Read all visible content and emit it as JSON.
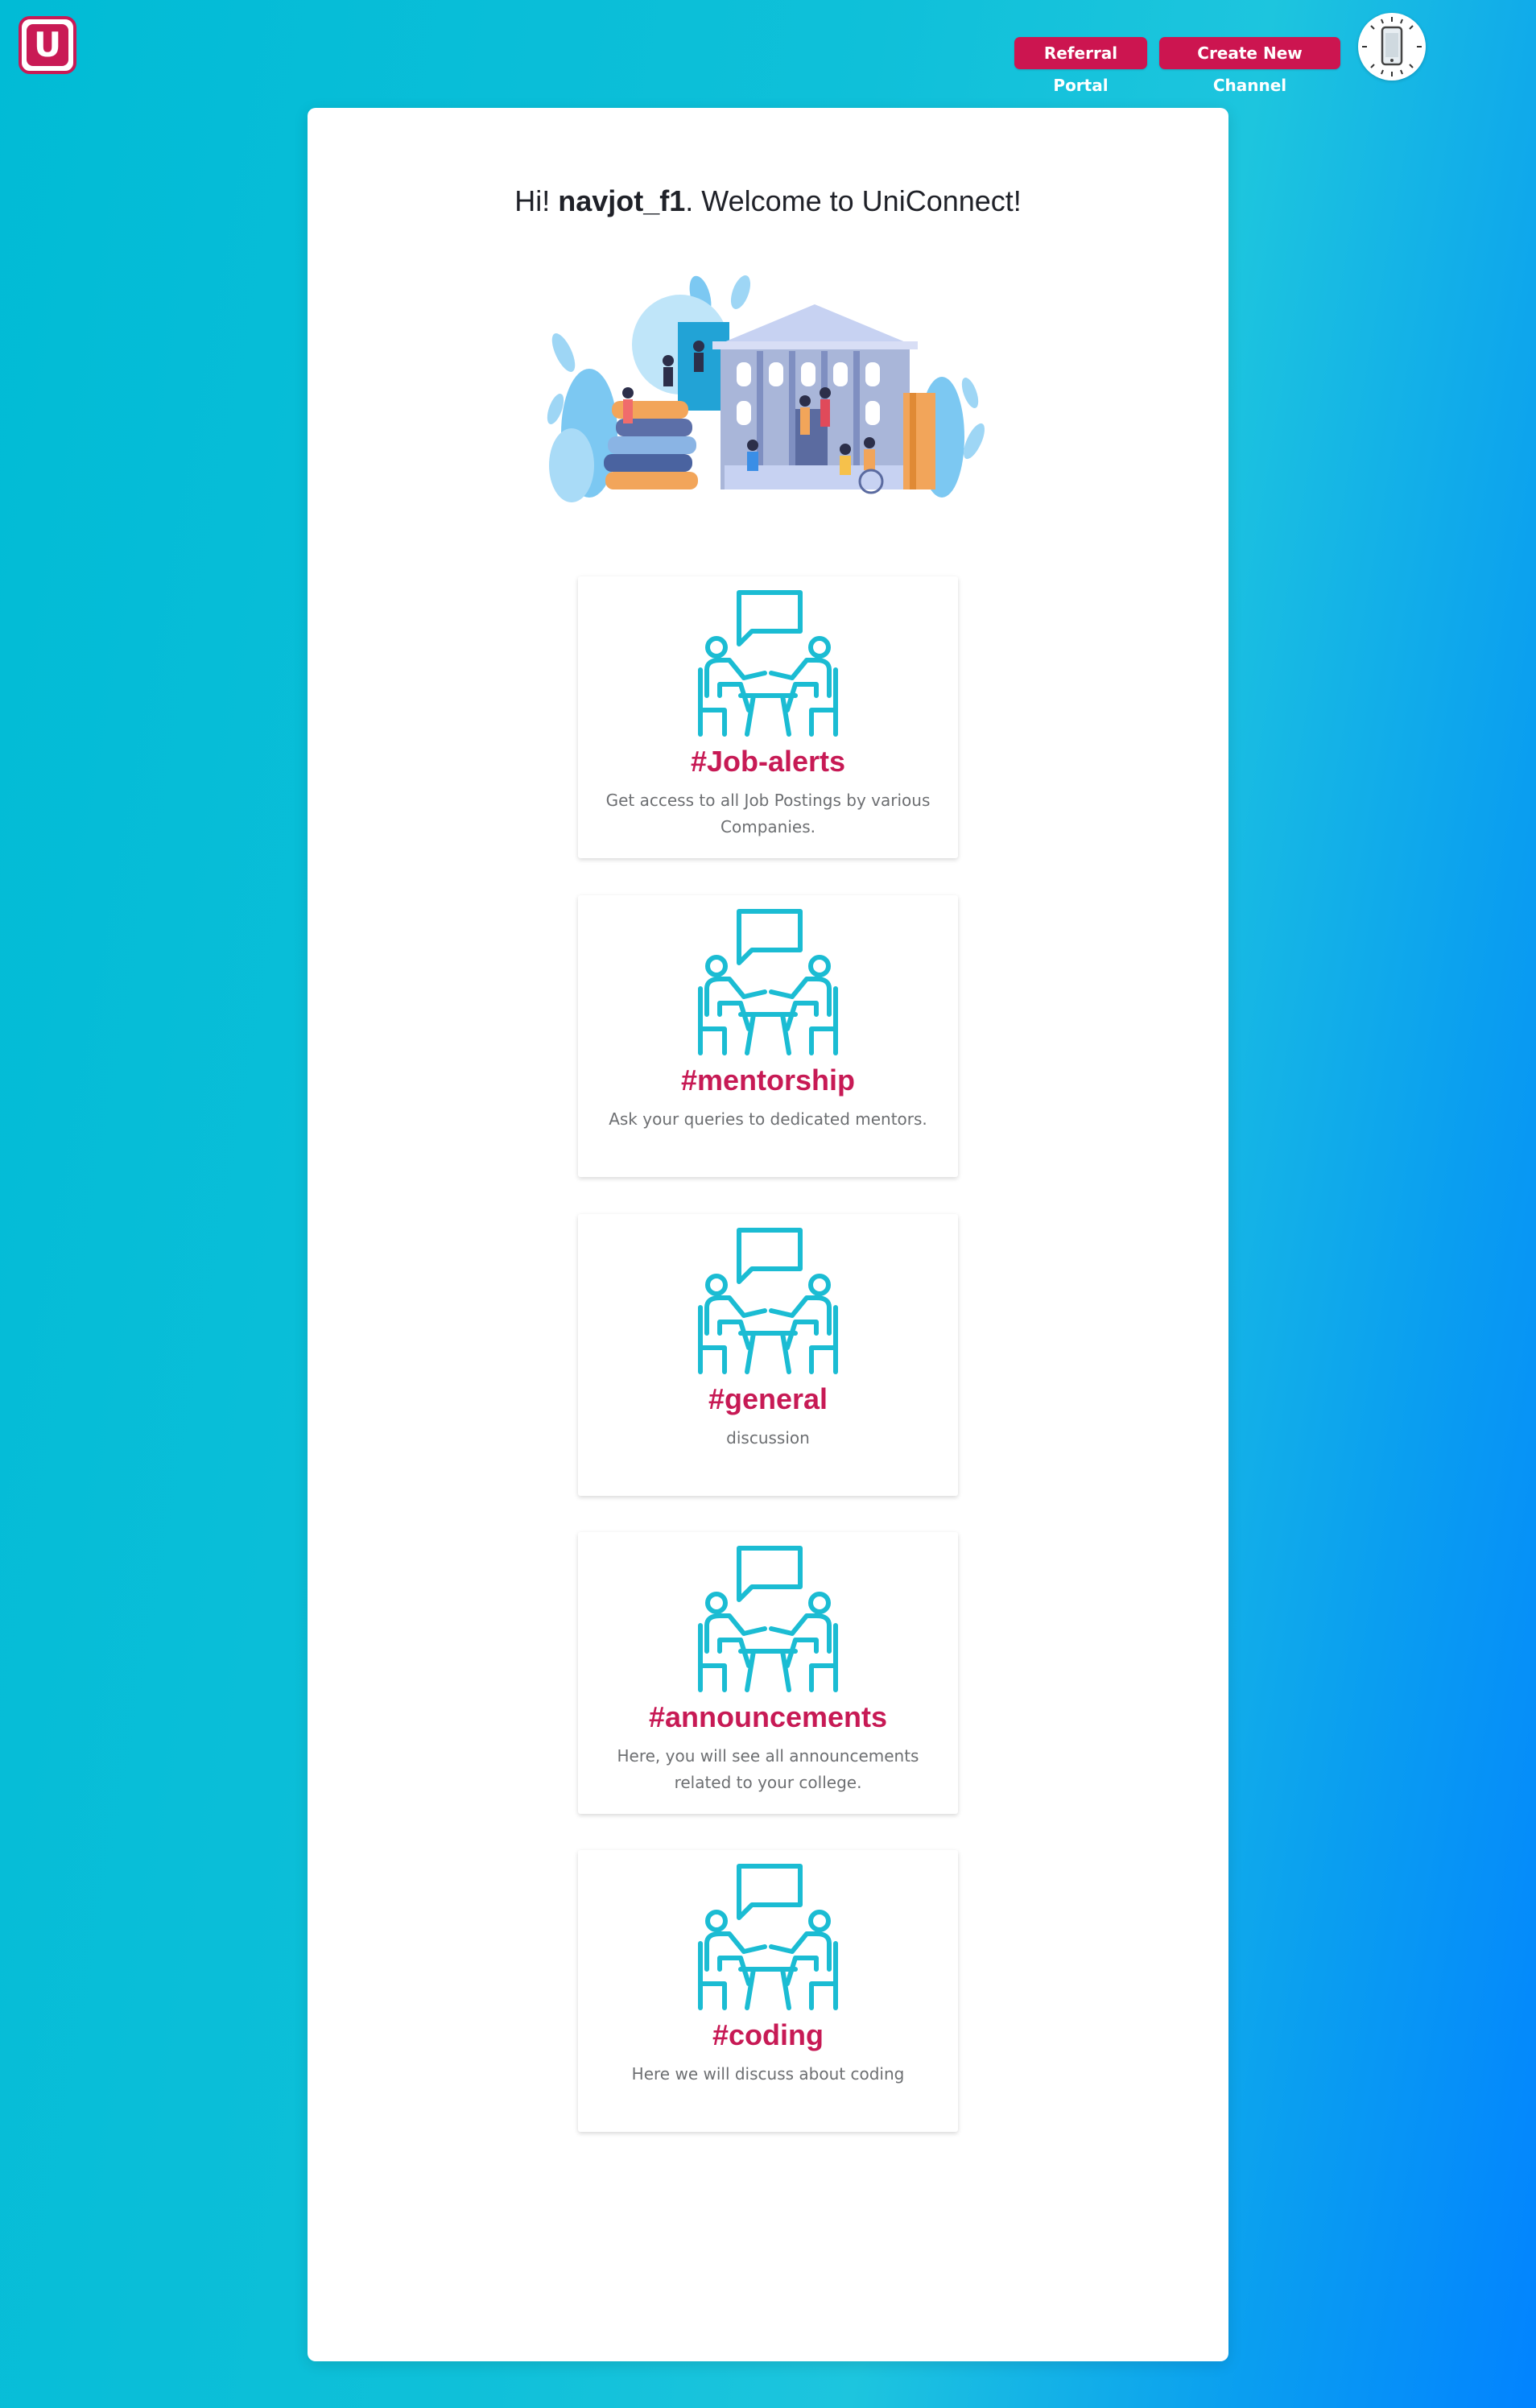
{
  "header": {
    "logo_letter": "U",
    "referral_label": "Referral Portal",
    "create_channel_label": "Create New Channel"
  },
  "welcome": {
    "greeting": "Hi!",
    "username": "navjot_f1",
    "message": ". Welcome to UniConnect!"
  },
  "channels": [
    {
      "title": "#Job-alerts",
      "description": "Get access to all Job Postings by various Companies."
    },
    {
      "title": "#mentorship",
      "description": "Ask your queries to dedicated mentors."
    },
    {
      "title": "#general",
      "description": "discussion"
    },
    {
      "title": "#announcements",
      "description": "Here, you will see all announcements related to your college."
    },
    {
      "title": "#coding",
      "description": "Here we will discuss about coding"
    }
  ],
  "icons": {
    "channel_icon": "people-meeting-chat-icon",
    "avatar_icon": "phone-clock-avatar-icon"
  },
  "colors": {
    "brand": "#c91a55",
    "accent_icon": "#1bbcd3"
  }
}
